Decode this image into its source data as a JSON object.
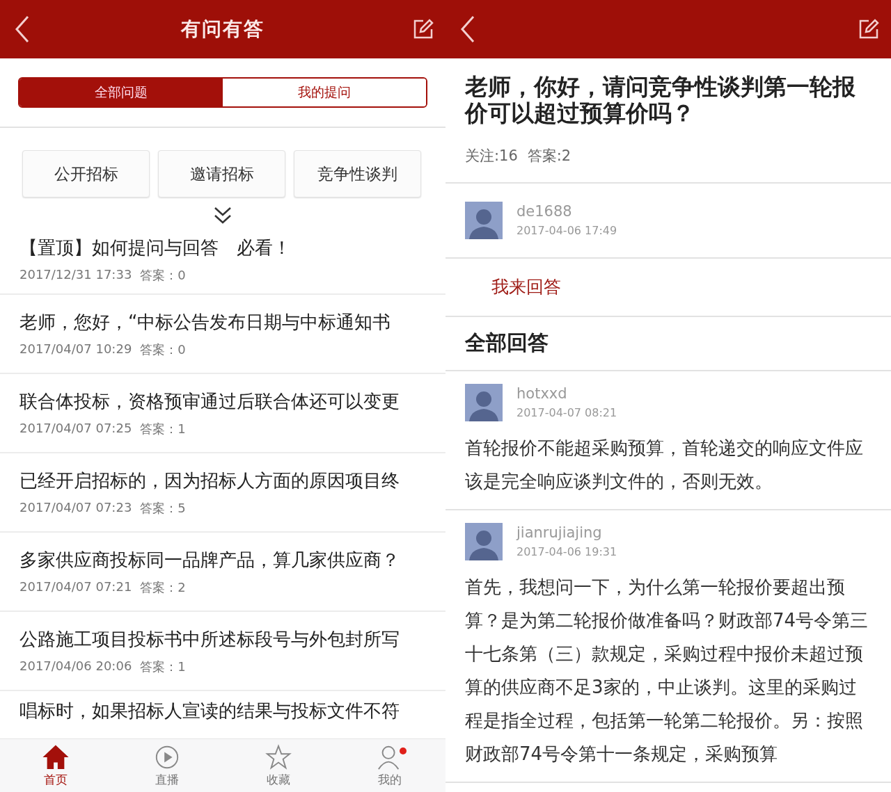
{
  "left": {
    "header": {
      "title": "有问有答"
    },
    "tabs": [
      {
        "label": "全部问题",
        "selected": true
      },
      {
        "label": "我的提问",
        "selected": false
      }
    ],
    "categories": [
      "公开招标",
      "邀请招标",
      "竞争性谈判"
    ],
    "questions": [
      {
        "title": "【置顶】如何提问与回答　必看！",
        "time": "2017/12/31 17:33",
        "answers": "答案：0"
      },
      {
        "title": "老师，您好，“中标公告发布日期与中标通知书",
        "time": "2017/04/07 10:29",
        "answers": "答案：0"
      },
      {
        "title": "联合体投标，资格预审通过后联合体还可以变更",
        "time": "2017/04/07 07:25",
        "answers": "答案：1"
      },
      {
        "title": "已经开启招标的，因为招标人方面的原因项目终",
        "time": "2017/04/07 07:23",
        "answers": "答案：5"
      },
      {
        "title": "多家供应商投标同一品牌产品，算几家供应商？",
        "time": "2017/04/07 07:21",
        "answers": "答案：2"
      },
      {
        "title": "公路施工项目投标书中所述标段号与外包封所写",
        "time": "2017/04/06 20:06",
        "answers": "答案：1"
      },
      {
        "title": "唱标时，如果招标人宣读的结果与投标文件不符"
      }
    ],
    "bottom_nav": [
      {
        "kind": "home",
        "label": "首页",
        "selected": true,
        "badge": false
      },
      {
        "kind": "play",
        "label": "直播",
        "selected": false,
        "badge": false
      },
      {
        "kind": "star",
        "label": "收藏",
        "selected": false,
        "badge": false
      },
      {
        "kind": "person",
        "label": "我的",
        "selected": false,
        "badge": true
      }
    ]
  },
  "right": {
    "question": {
      "title": "老师，你好，请问竞争性谈判第一轮报价可以超过预算价吗？",
      "follows": "关注:16",
      "answers": "答案:2",
      "user": "de1688",
      "time": "2017-04-06 17:49"
    },
    "answer_button": "我来回答",
    "section_title": "全部回答",
    "answers": [
      {
        "user": "hotxxd",
        "time": "2017-04-07 08:21",
        "text": "首轮报价不能超采购预算，首轮递交的响应文件应该是完全响应谈判文件的，否则无效。"
      },
      {
        "user": "jianrujiajing",
        "time": "2017-04-06 19:31",
        "text": "首先，我想问一下，为什么第一轮报价要超出预算？是为第二轮报价做准备吗？财政部74号令第三十七条第（三）款规定，采购过程中报价未超过预算的供应商不足3家的，中止谈判。这里的采购过程是指全过程，包括第一轮第二轮报价。另：按照财政部74号令第十一条规定，采购预算"
      }
    ]
  }
}
